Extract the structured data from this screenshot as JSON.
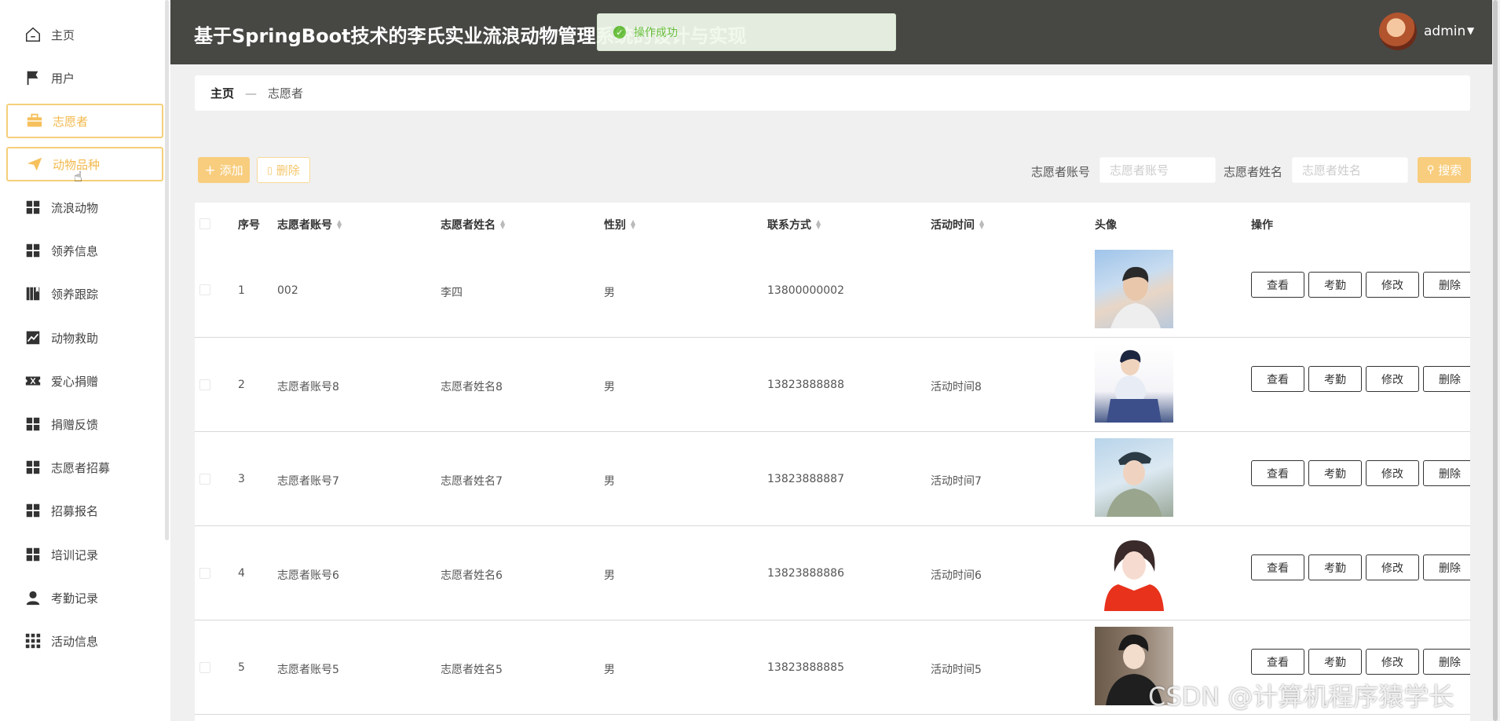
{
  "sidebar": {
    "items": [
      {
        "label": "主页",
        "icon": "home-icon"
      },
      {
        "label": "用户",
        "icon": "flag-icon"
      },
      {
        "label": "志愿者",
        "icon": "briefcase-icon"
      },
      {
        "label": "动物品种",
        "icon": "paper-plane-icon"
      },
      {
        "label": "流浪动物",
        "icon": "grid-icon"
      },
      {
        "label": "领养信息",
        "icon": "grid-icon"
      },
      {
        "label": "领养跟踪",
        "icon": "book-icon"
      },
      {
        "label": "动物救助",
        "icon": "chart-line-icon"
      },
      {
        "label": "爱心捐赠",
        "icon": "ticket-icon"
      },
      {
        "label": "捐赠反馈",
        "icon": "grid-icon"
      },
      {
        "label": "志愿者招募",
        "icon": "grid-icon"
      },
      {
        "label": "招募报名",
        "icon": "grid-icon"
      },
      {
        "label": "培训记录",
        "icon": "grid-icon"
      },
      {
        "label": "考勤记录",
        "icon": "person-icon"
      },
      {
        "label": "活动信息",
        "icon": "apps-icon"
      }
    ]
  },
  "header": {
    "title": "基于SpringBoot技术的李氏实业流浪动物管理系统的设计与实现",
    "username": "admin"
  },
  "toast": {
    "message": "操作成功"
  },
  "breadcrumb": {
    "home": "主页",
    "separator": "—",
    "current": "志愿者"
  },
  "toolbar": {
    "add_label": "添加",
    "delete_label": "删除",
    "search_label": "搜索",
    "account_label": "志愿者账号",
    "account_placeholder": "志愿者账号",
    "name_label": "志愿者姓名",
    "name_placeholder": "志愿者姓名"
  },
  "table": {
    "headers": {
      "index": "序号",
      "account": "志愿者账号",
      "name": "志愿者姓名",
      "gender": "性别",
      "contact": "联系方式",
      "activity_time": "活动时间",
      "avatar": "头像",
      "actions": "操作"
    },
    "actions": {
      "view": "查看",
      "attendance": "考勤",
      "edit": "修改",
      "delete": "删除"
    },
    "rows": [
      {
        "index": "1",
        "account": "002",
        "name": "李四",
        "gender": "男",
        "contact": "13800000002",
        "activity_time": ""
      },
      {
        "index": "2",
        "account": "志愿者账号8",
        "name": "志愿者姓名8",
        "gender": "男",
        "contact": "13823888888",
        "activity_time": "活动时间8"
      },
      {
        "index": "3",
        "account": "志愿者账号7",
        "name": "志愿者姓名7",
        "gender": "男",
        "contact": "13823888887",
        "activity_time": "活动时间7"
      },
      {
        "index": "4",
        "account": "志愿者账号6",
        "name": "志愿者姓名6",
        "gender": "男",
        "contact": "13823888886",
        "activity_time": "活动时间6"
      },
      {
        "index": "5",
        "account": "志愿者账号5",
        "name": "志愿者姓名5",
        "gender": "男",
        "contact": "13823888885",
        "activity_time": "活动时间5"
      }
    ]
  },
  "watermark": "CSDN @计算机程序猿学长",
  "colors": {
    "accent": "#f8cd7e",
    "header_bg": "#474744",
    "success": "#67c23a"
  }
}
